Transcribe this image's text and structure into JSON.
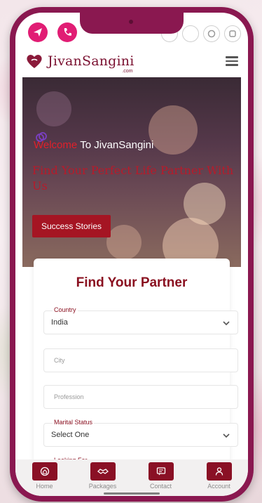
{
  "topbar": {
    "left_icons": [
      "send-icon",
      "phone-icon"
    ],
    "right_icons": [
      "social-icon",
      "social-icon",
      "social-icon",
      "social-icon"
    ]
  },
  "header": {
    "logo_name": "JivanSangini",
    "logo_sub": ".com",
    "menu_icon": "menu-icon"
  },
  "hero": {
    "welcome_red": "Welcome",
    "welcome_white": "To JivanSangini",
    "title": "Find Your Perfect Life Partner With Us",
    "button": "Success Stories"
  },
  "form": {
    "title": "Find Your Partner",
    "country_label": "Country",
    "country_value": "India",
    "city_placeholder": "City",
    "profession_placeholder": "Profession",
    "marital_label": "Marital Status",
    "marital_value": "Select One",
    "looking_label": "Looking For"
  },
  "bottom_nav": [
    {
      "label": "Home",
      "icon": "home-icon"
    },
    {
      "label": "Packages",
      "icon": "packages-icon"
    },
    {
      "label": "Contact",
      "icon": "contact-icon"
    },
    {
      "label": "Account",
      "icon": "account-icon"
    }
  ],
  "colors": {
    "brand": "#8a1850",
    "accent_red": "#a51523",
    "pink": "#e11d74"
  }
}
